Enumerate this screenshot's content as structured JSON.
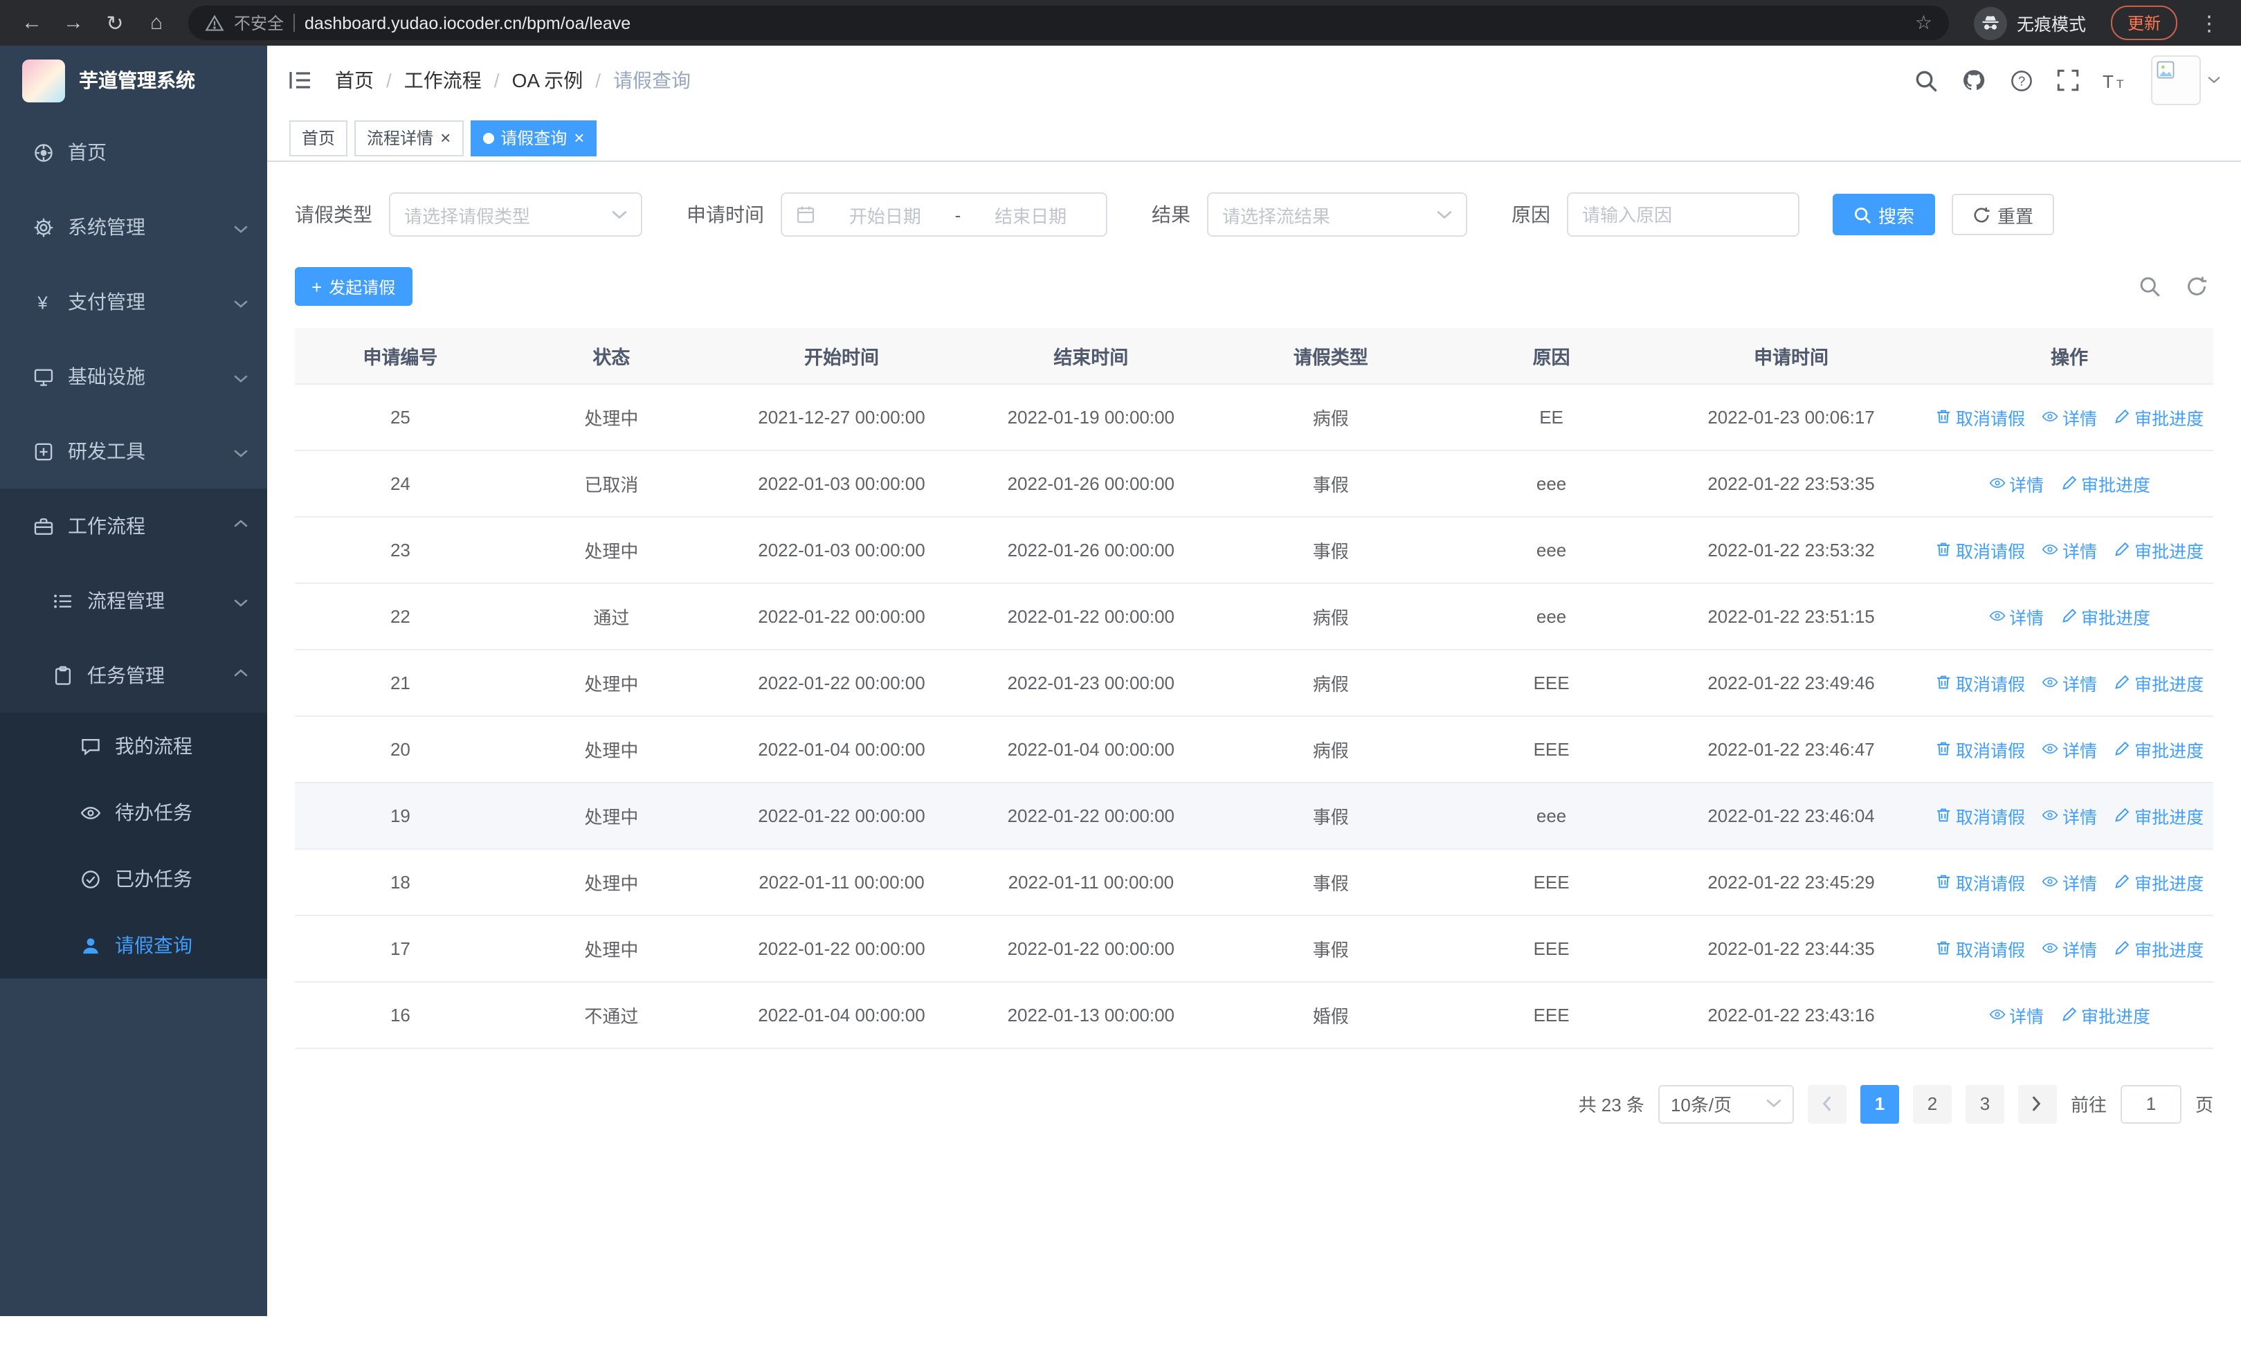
{
  "browser": {
    "security_warning": "不安全",
    "url": "dashboard.yudao.iocoder.cn/bpm/oa/leave",
    "incognito_label": "无痕模式",
    "update_label": "更新"
  },
  "icons": {
    "back": "←",
    "forward": "→",
    "reload": "↻",
    "home": "⌂",
    "star": "☆",
    "menu_dots": "⋮",
    "close": "×",
    "plus": "+"
  },
  "sidebar": {
    "logo_title": "芋道管理系统",
    "items": [
      {
        "label": "首页"
      },
      {
        "label": "系统管理"
      },
      {
        "label": "支付管理"
      },
      {
        "label": "基础设施"
      },
      {
        "label": "研发工具"
      },
      {
        "label": "工作流程"
      }
    ],
    "submenu": {
      "process_mgmt": "流程管理",
      "task_mgmt": "任务管理",
      "task_children": [
        {
          "label": "我的流程"
        },
        {
          "label": "待办任务"
        },
        {
          "label": "已办任务"
        },
        {
          "label": "请假查询"
        }
      ]
    }
  },
  "breadcrumb": {
    "separator": "/",
    "items": [
      "首页",
      "工作流程",
      "OA 示例",
      "请假查询"
    ]
  },
  "tabs": [
    {
      "label": "首页"
    },
    {
      "label": "流程详情"
    },
    {
      "label": "请假查询"
    }
  ],
  "filters": {
    "leave_type_label": "请假类型",
    "leave_type_placeholder": "请选择请假类型",
    "apply_time_label": "申请时间",
    "start_date_placeholder": "开始日期",
    "range_separator": "-",
    "end_date_placeholder": "结束日期",
    "result_label": "结果",
    "result_placeholder": "请选择流结果",
    "reason_label": "原因",
    "reason_placeholder": "请输入原因",
    "search_label": "搜索",
    "reset_label": "重置"
  },
  "toolbar": {
    "create_label": "发起请假"
  },
  "actions": {
    "cancel": "取消请假",
    "detail": "详情",
    "progress": "审批进度"
  },
  "table": {
    "headers": [
      "申请编号",
      "状态",
      "开始时间",
      "结束时间",
      "请假类型",
      "原因",
      "申请时间",
      "操作"
    ],
    "rows": [
      {
        "id": "25",
        "status": "处理中",
        "start": "2021-12-27 00:00:00",
        "end": "2022-01-19 00:00:00",
        "type": "病假",
        "reason": "EE",
        "applied": "2022-01-23 00:06:17",
        "actions": [
          "cancel",
          "detail",
          "progress"
        ],
        "highlight": false
      },
      {
        "id": "24",
        "status": "已取消",
        "start": "2022-01-03 00:00:00",
        "end": "2022-01-26 00:00:00",
        "type": "事假",
        "reason": "eee",
        "applied": "2022-01-22 23:53:35",
        "actions": [
          "detail",
          "progress"
        ],
        "highlight": false
      },
      {
        "id": "23",
        "status": "处理中",
        "start": "2022-01-03 00:00:00",
        "end": "2022-01-26 00:00:00",
        "type": "事假",
        "reason": "eee",
        "applied": "2022-01-22 23:53:32",
        "actions": [
          "cancel",
          "detail",
          "progress"
        ],
        "highlight": false
      },
      {
        "id": "22",
        "status": "通过",
        "start": "2022-01-22 00:00:00",
        "end": "2022-01-22 00:00:00",
        "type": "病假",
        "reason": "eee",
        "applied": "2022-01-22 23:51:15",
        "actions": [
          "detail",
          "progress"
        ],
        "highlight": false
      },
      {
        "id": "21",
        "status": "处理中",
        "start": "2022-01-22 00:00:00",
        "end": "2022-01-23 00:00:00",
        "type": "病假",
        "reason": "EEE",
        "applied": "2022-01-22 23:49:46",
        "actions": [
          "cancel",
          "detail",
          "progress"
        ],
        "highlight": false
      },
      {
        "id": "20",
        "status": "处理中",
        "start": "2022-01-04 00:00:00",
        "end": "2022-01-04 00:00:00",
        "type": "病假",
        "reason": "EEE",
        "applied": "2022-01-22 23:46:47",
        "actions": [
          "cancel",
          "detail",
          "progress"
        ],
        "highlight": false
      },
      {
        "id": "19",
        "status": "处理中",
        "start": "2022-01-22 00:00:00",
        "end": "2022-01-22 00:00:00",
        "type": "事假",
        "reason": "eee",
        "applied": "2022-01-22 23:46:04",
        "actions": [
          "cancel",
          "detail",
          "progress"
        ],
        "highlight": true
      },
      {
        "id": "18",
        "status": "处理中",
        "start": "2022-01-11 00:00:00",
        "end": "2022-01-11 00:00:00",
        "type": "事假",
        "reason": "EEE",
        "applied": "2022-01-22 23:45:29",
        "actions": [
          "cancel",
          "detail",
          "progress"
        ],
        "highlight": false
      },
      {
        "id": "17",
        "status": "处理中",
        "start": "2022-01-22 00:00:00",
        "end": "2022-01-22 00:00:00",
        "type": "事假",
        "reason": "EEE",
        "applied": "2022-01-22 23:44:35",
        "actions": [
          "cancel",
          "detail",
          "progress"
        ],
        "highlight": false
      },
      {
        "id": "16",
        "status": "不通过",
        "start": "2022-01-04 00:00:00",
        "end": "2022-01-13 00:00:00",
        "type": "婚假",
        "reason": "EEE",
        "applied": "2022-01-22 23:43:16",
        "actions": [
          "detail",
          "progress"
        ],
        "highlight": false
      }
    ]
  },
  "pagination": {
    "total": "共 23 条",
    "page_size": "10条/页",
    "pages": [
      "1",
      "2",
      "3"
    ],
    "active_page": "1",
    "goto_label": "前往",
    "goto_value": "1",
    "page_unit": "页"
  },
  "colors": {
    "primary": "#409eff",
    "sidebar_bg": "#304156",
    "sidebar_sub_bg": "#1f2d3d"
  }
}
